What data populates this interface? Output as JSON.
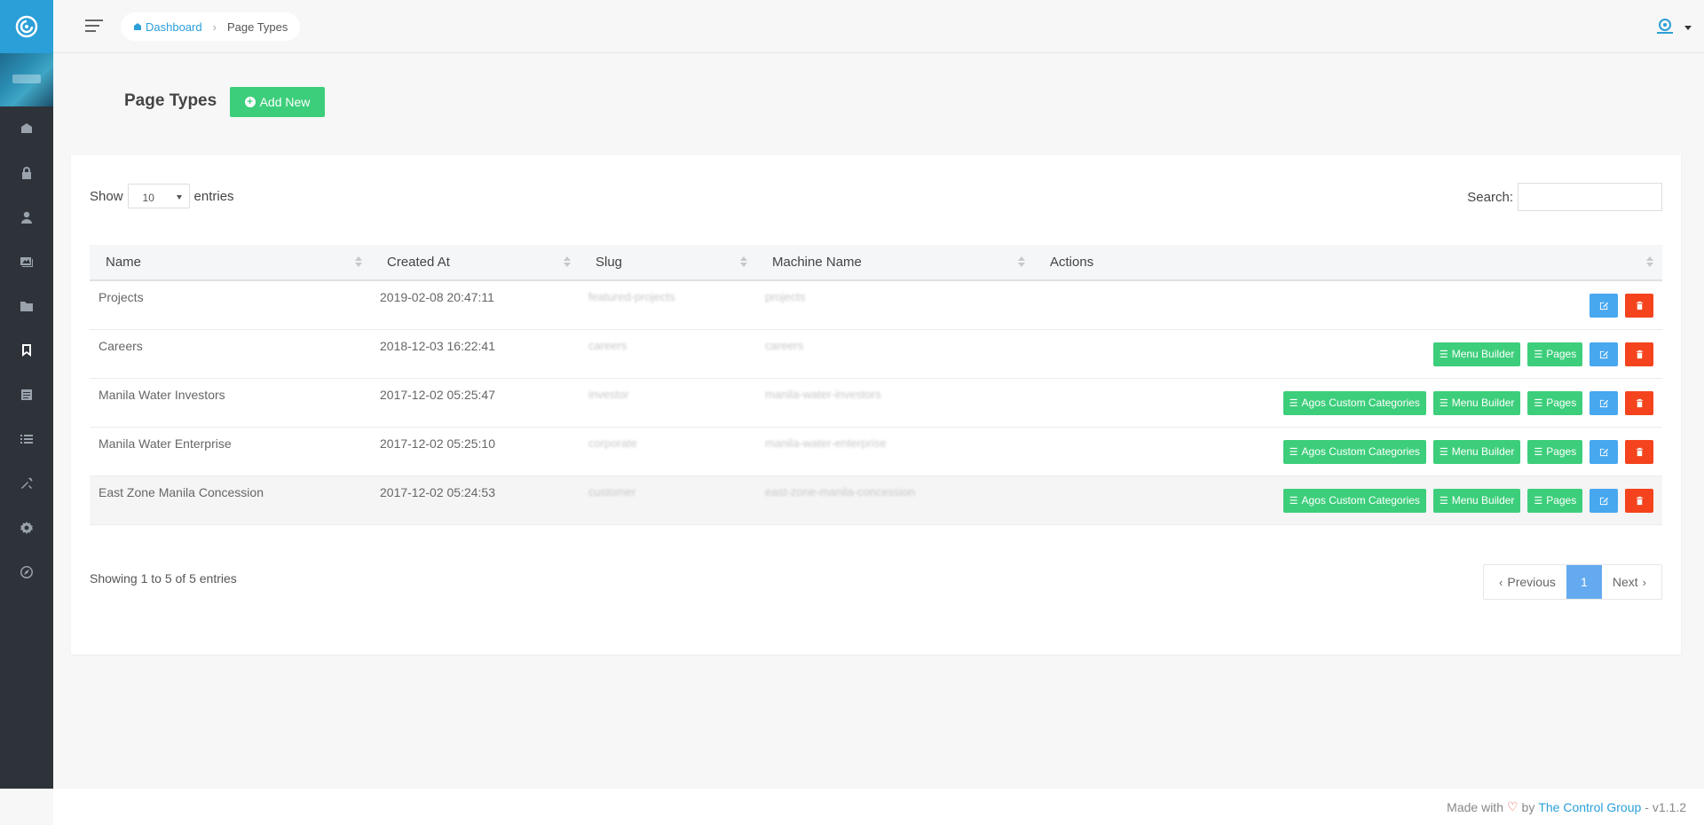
{
  "breadcrumb": {
    "home": "Dashboard",
    "current": "Page Types"
  },
  "page": {
    "title": "Page Types",
    "add_new_label": "Add New"
  },
  "datatable": {
    "show_label": "Show",
    "entries_label": "entries",
    "page_length": "10",
    "search_label": "Search:",
    "columns": [
      "Name",
      "Created At",
      "Slug",
      "Machine Name",
      "Actions"
    ],
    "rows": [
      {
        "name": "Projects",
        "created_at": "2019-02-08 20:47:11",
        "slug": "featured-projects",
        "machine_name": "projects"
      },
      {
        "name": "Careers",
        "created_at": "2018-12-03 16:22:41",
        "slug": "careers",
        "machine_name": "careers"
      },
      {
        "name": "Manila Water Investors",
        "created_at": "2017-12-02 05:25:47",
        "slug": "investor",
        "machine_name": "manila-water-investors"
      },
      {
        "name": "Manila Water Enterprise",
        "created_at": "2017-12-02 05:25:10",
        "slug": "corporate",
        "machine_name": "manila-water-enterprise"
      },
      {
        "name": "East Zone Manila Concession",
        "created_at": "2017-12-02 05:24:53",
        "slug": "customer",
        "machine_name": "east-zone-manila-concession"
      }
    ],
    "actions": {
      "custom_categories": "Agos Custom Categories",
      "menu_builder": "Menu Builder",
      "pages": "Pages"
    },
    "info": "Showing 1 to 5 of 5 entries",
    "pagination": {
      "previous": "Previous",
      "current": "1",
      "next": "Next"
    }
  },
  "footer": {
    "made_with": "Made with",
    "by": "by",
    "company": "The Control Group",
    "version": "- v1.1.2"
  },
  "icons": {
    "sidebar": [
      "dashboard-icon",
      "lock-icon",
      "user-icon",
      "images-icon",
      "folder-icon",
      "bookmark-icon",
      "page-icon",
      "list-icon",
      "tools-icon",
      "gear-icon",
      "compass-icon"
    ]
  },
  "colors": {
    "primary": "#2a9fd8",
    "success": "#3dce7b",
    "info": "#47a7ef",
    "danger": "#f4431d",
    "sidebar": "#2e3339"
  }
}
